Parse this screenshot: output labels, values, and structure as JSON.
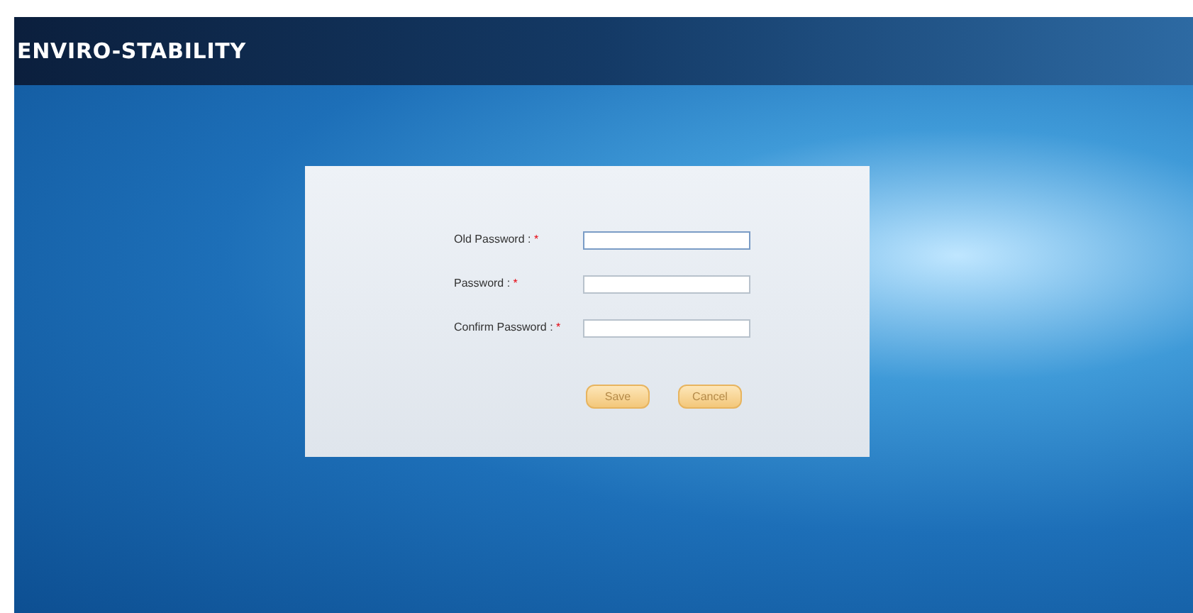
{
  "app_title": "ENVIRO-STABILITY",
  "form": {
    "fields": [
      {
        "label": "Old Password :",
        "required_mark": "*",
        "focused": true
      },
      {
        "label": "Password :",
        "required_mark": "*",
        "focused": false
      },
      {
        "label": "Confirm Password :",
        "required_mark": "*",
        "focused": false
      }
    ],
    "buttons": [
      "Save",
      "Cancel"
    ]
  }
}
